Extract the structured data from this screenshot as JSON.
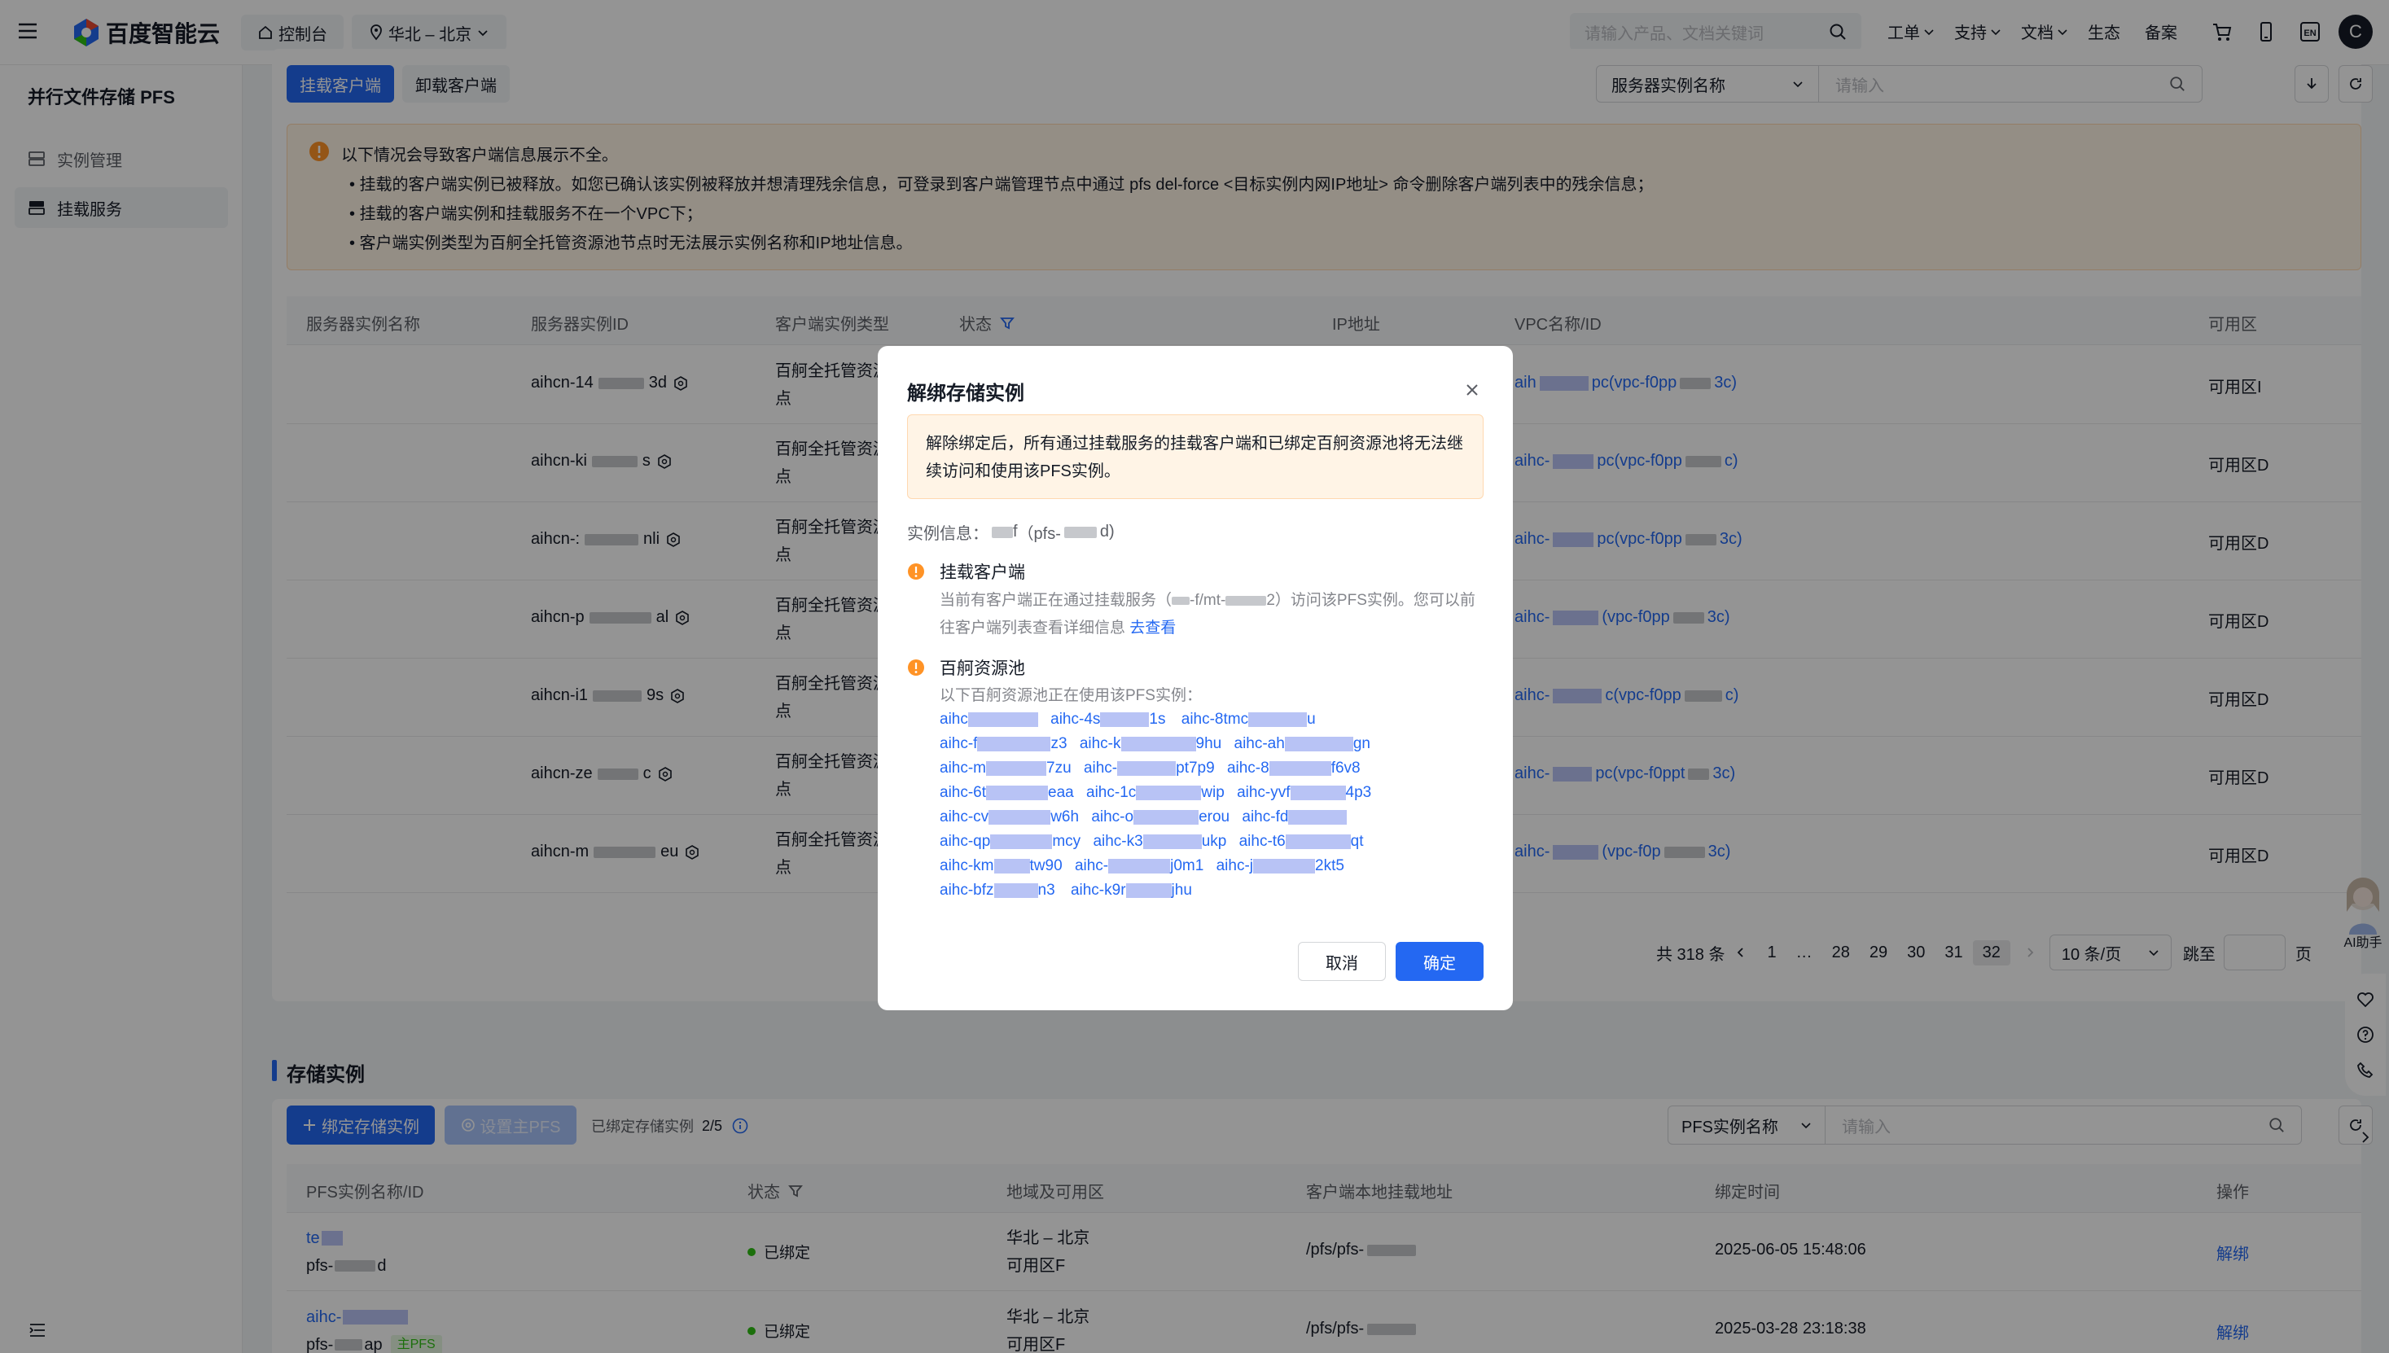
{
  "topbar": {
    "brand": "百度智能云",
    "console": "控制台",
    "region": "华北 – 北京",
    "search_placeholder": "请输入产品、文档关键词",
    "nav": [
      "工单",
      "支持",
      "文档",
      "生态",
      "备案"
    ],
    "avatar": "C"
  },
  "sidebar": {
    "title": "并行文件存储 PFS",
    "items": [
      {
        "label": "实例管理",
        "active": false
      },
      {
        "label": "挂载服务",
        "active": true
      }
    ]
  },
  "clients": {
    "mount_button": "挂载客户端",
    "unmount_button": "卸载客户端",
    "filter_select": "服务器实例名称",
    "filter_placeholder": "请输入",
    "notice": {
      "title": "以下情况会导致客户端信息展示不全。",
      "lines": [
        "• 挂载的客户端实例已被释放。如您已确认该实例被释放并想清理残余信息，可登录到客户端管理节点中通过 pfs del-force <目标实例内网IP地址> 命令删除客户端列表中的残余信息；",
        "• 挂载的客户端实例和挂载服务不在一个VPC下；",
        "• 客户端实例类型为百舸全托管资源池节点时无法展示实例名称和IP地址信息。"
      ]
    },
    "columns": [
      "服务器实例名称",
      "服务器实例ID",
      "客户端实例类型",
      "状态",
      "IP地址",
      "VPC名称/ID",
      "可用区"
    ],
    "rows": [
      {
        "id_a": "aihcn-14",
        "id_b": "3d",
        "type": "百舸全托管资源",
        "type2": "点",
        "vpc_a": "aih",
        "vpc_b": "pc(vpc-f0pp",
        "vpc_c": "3c)",
        "zone": "可用区I"
      },
      {
        "id_a": "aihcn-ki",
        "id_b": "s",
        "type": "百舸全托管资源",
        "type2": "点",
        "vpc_a": "aihc-",
        "vpc_b": "pc(vpc-f0pp",
        "vpc_c": "c)",
        "zone": "可用区D"
      },
      {
        "id_a": "aihcn-:",
        "id_b": "nli",
        "type": "百舸全托管资源",
        "type2": "点",
        "vpc_a": "aihc-",
        "vpc_b": "pc(vpc-f0pp",
        "vpc_c": "3c)",
        "zone": "可用区D"
      },
      {
        "id_a": "aihcn-p",
        "id_b": "al",
        "type": "百舸全托管资源",
        "type2": "点",
        "vpc_a": "aihc-",
        "vpc_b": "(vpc-f0pp",
        "vpc_c": "3c)",
        "zone": "可用区D"
      },
      {
        "id_a": "aihcn-i1",
        "id_b": "9s",
        "type": "百舸全托管资源",
        "type2": "点",
        "vpc_a": "aihc-",
        "vpc_b": "c(vpc-f0pp",
        "vpc_c": "c)",
        "zone": "可用区D"
      },
      {
        "id_a": "aihcn-ze",
        "id_b": "c",
        "type": "百舸全托管资源",
        "type2": "点",
        "vpc_a": "aihc-",
        "vpc_b": "pc(vpc-f0ppt",
        "vpc_c": "3c)",
        "zone": "可用区D"
      },
      {
        "id_a": "aihcn-m",
        "id_b": "eu",
        "type": "百舸全托管资源",
        "type2": "点",
        "vpc_a": "aihc-",
        "vpc_b": "(vpc-f0p",
        "vpc_c": "3c)",
        "zone": "可用区D"
      }
    ],
    "pagination": {
      "total": "共 318 条",
      "pages": [
        "1",
        "…",
        "28",
        "29",
        "30",
        "31",
        "32"
      ],
      "current": "32",
      "page_size": "10 条/页",
      "jump_label": "跳至",
      "jump_suffix": "页"
    }
  },
  "storage": {
    "title": "存储实例",
    "bind_button": "绑定存储实例",
    "set_primary_button": "设置主PFS",
    "bound_label": "已绑定存储实例",
    "bound_count": "2/5",
    "filter_select": "PFS实例名称",
    "filter_placeholder": "请输入",
    "columns": [
      "PFS实例名称/ID",
      "状态",
      "地域及可用区",
      "客户端本地挂载地址",
      "绑定时间",
      "操作"
    ],
    "rows": [
      {
        "name": "te",
        "id": "pfs-",
        "id_tail": "d",
        "status": "已绑定",
        "region": "华北 – 北京",
        "zone": "可用区F",
        "path": "/pfs/pfs-",
        "time": "2025-06-05 15:48:06",
        "action": "解绑",
        "tag": ""
      },
      {
        "name": "aihc-",
        "id": "pfs-",
        "id_tail": "ap",
        "status": "已绑定",
        "region": "华北 – 北京",
        "zone": "可用区F",
        "path": "/pfs/pfs-",
        "time": "2025-03-28 23:18:38",
        "action": "解绑",
        "tag": "主PFS"
      }
    ]
  },
  "assistant": {
    "label": "AI助手"
  },
  "modal": {
    "title": "解绑存储实例",
    "warning": "解除绑定后，所有通过挂载服务的挂载客户端和已绑定百舸资源池将无法继续访问和使用该PFS实例。",
    "instance_label": "实例信息：",
    "instance_a": "f",
    "instance_b": "（pfs-",
    "instance_c": "d)",
    "section1": {
      "title": "挂载客户端",
      "desc_a": "当前有客户端正在通过挂载服务（",
      "desc_b": "-f/mt-",
      "desc_c": "2）访问该PFS实例。您可以前往客户端列表查看详细信息",
      "link": "去查看"
    },
    "section2": {
      "title": "百舸资源池",
      "desc": "以下百舸资源池正在使用该PFS实例：",
      "pools": [
        [
          "aihc",
          "aihc-4s",
          "1s",
          "aihc-8tmc",
          "u"
        ],
        [
          "aihc-f",
          "z3",
          "aihc-k",
          "9hu",
          "aihc-ah",
          "gn"
        ],
        [
          "aihc-m",
          "7zu",
          "aihc-",
          "pt7p9",
          "aihc-8",
          "f6v8"
        ],
        [
          "aihc-6t",
          "eaa",
          "aihc-1c",
          "wip",
          "aihc-yvf",
          "4p3"
        ],
        [
          "aihc-cv",
          "w6h",
          "aihc-o",
          "erou",
          "aihc-fd"
        ],
        [
          "aihc-qp",
          "mcy",
          "aihc-k3",
          "ukp",
          "aihc-t6",
          "qt"
        ],
        [
          "aihc-km",
          "tw90",
          "aihc-",
          "j0m1",
          "aihc-j",
          "2kt5"
        ],
        [
          "aihc-bfz",
          "n3",
          "aihc-k9r",
          "jhu"
        ]
      ]
    },
    "cancel": "取消",
    "confirm": "确定"
  },
  "colors": {
    "primary": "#2468f2",
    "warning": "#ff9326",
    "success": "#30bf13",
    "notice_bg": "#fff4e6"
  }
}
